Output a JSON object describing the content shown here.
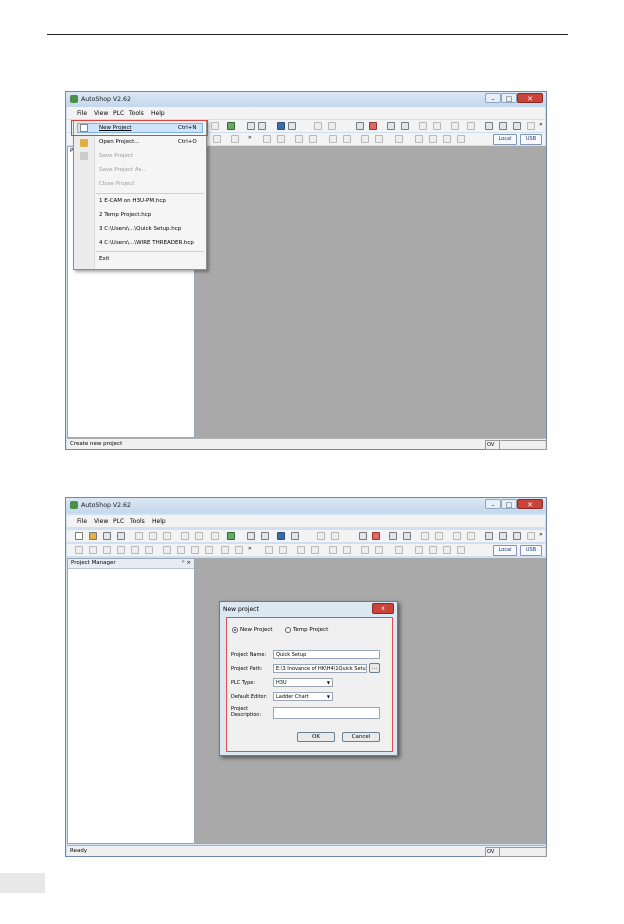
{
  "app_title": "AutoShop V2.62",
  "menu": [
    "File",
    "View",
    "PLC",
    "Tools",
    "Help"
  ],
  "toolbar": {
    "local": "Local",
    "usb": "USB",
    "overflow": "»"
  },
  "file_menu": {
    "items": [
      {
        "label": "New Project",
        "shortcut": "Ctrl+N",
        "enabled": true
      },
      {
        "label": "Open Project...",
        "shortcut": "Ctrl+O",
        "enabled": true
      },
      {
        "label": "Save Project",
        "enabled": false
      },
      {
        "label": "Save Project As...",
        "enabled": false
      },
      {
        "label": "Close Project",
        "enabled": false
      }
    ],
    "recent": [
      "1 E-CAM on H3U-PM.hcp",
      "2 Temp Project.hcp",
      "3 C:\\Users\\...\\Quick Setup.hcp",
      "4 C:\\Users\\...\\WIRE THREADER.hcp"
    ],
    "exit": "Exit"
  },
  "screen1": {
    "status": "Create new project",
    "status_mode": "OV",
    "panel_letter": "P"
  },
  "screen2": {
    "panel_title": "Project Manager",
    "panel_controls": "ᵖ ×",
    "status": "Ready",
    "status_mode": "OV",
    "dialog": {
      "title": "New project",
      "close": "x",
      "radio_new": "New Project",
      "radio_temp": "Temp Project",
      "name_label": "Project Name:",
      "name_value": "Quick Setup",
      "path_label": "Project Path:",
      "path_value": "E:\\3 Inovance of HK\\H4\\1Quick Setu",
      "browse": "...",
      "plc_label": "PLC Type:",
      "plc_value": "H3U",
      "editor_label": "Default Editor:",
      "editor_value": "Ladder Chart",
      "desc_label": "Project\nDescription:",
      "ok": "OK",
      "cancel": "Cancel"
    }
  },
  "colors": {
    "workarea": "#a9a9a9",
    "highlight": "#e04040",
    "menu_hover": "#cde4fa"
  }
}
